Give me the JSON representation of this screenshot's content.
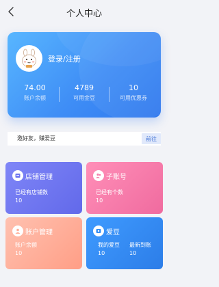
{
  "header": {
    "title": "个人中心"
  },
  "profile": {
    "login_label": "登录/注册",
    "stats": [
      {
        "value": "74.00",
        "label": "账户余额"
      },
      {
        "value": "4789",
        "label": "可用金豆"
      },
      {
        "value": "10",
        "label": "可用优惠券"
      }
    ]
  },
  "invite": {
    "text": "邀好友，赚爱豆",
    "button_label": "前往"
  },
  "tiles": {
    "shop": {
      "title": "店铺管理",
      "line1": "已经有店铺数",
      "line2": "10"
    },
    "subaccount": {
      "title": "子账号",
      "line1": "已经有个数",
      "line2": "10"
    },
    "account": {
      "title": "账户管理",
      "line1": "账户余额",
      "line2": "10"
    },
    "bean": {
      "title": "爱豆",
      "col1_label": "我的爱豆",
      "col1_value": "10",
      "col2_label": "最新到账",
      "col2_value": "10"
    }
  },
  "colors": {
    "card_blue": "#3f8ef6",
    "shop_tile": "#6f76f0",
    "subaccount_tile": "#f47aa8",
    "account_tile": "#ffae98",
    "bean_tile": "#348ef4",
    "button_text": "#3b6fd4"
  },
  "icons": {
    "back": "chevron-left-icon",
    "shop": "shop-icon",
    "subaccount": "users-icon",
    "account": "user-icon",
    "bean": "bean-icon"
  }
}
